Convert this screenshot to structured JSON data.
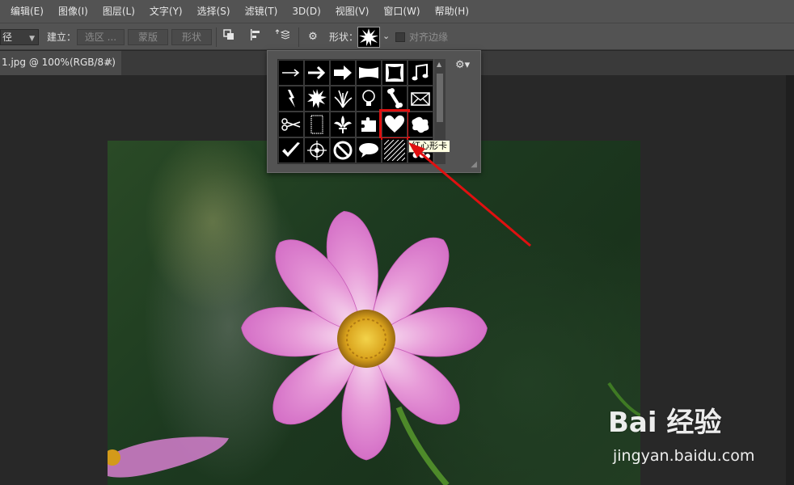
{
  "menu": [
    "编辑(E)",
    "图像(I)",
    "图层(L)",
    "文字(Y)",
    "选择(S)",
    "滤镜(T)",
    "3D(D)",
    "视图(V)",
    "窗口(W)",
    "帮助(H)"
  ],
  "options": {
    "mode_select": "径",
    "build_label": "建立：",
    "selection_btn": "选区 ...",
    "mask_btn": "蒙版",
    "shape_btn": "形状",
    "shape_label": "形状：",
    "align_edges_label": "对齐边缘"
  },
  "tab": {
    "title": "1.jpg @ 100%(RGB/8#)",
    "close": "×"
  },
  "shape_picker": {
    "shapes": [
      "arrow-thin-icon",
      "arrow-bold-icon",
      "arrow-fat-icon",
      "banner-icon",
      "frame-icon",
      "music-note-icon",
      "lightning-icon",
      "burst-icon",
      "grass-icon",
      "lightbulb-icon",
      "bone-icon",
      "envelope-icon",
      "scissors-icon",
      "frame-rect-icon",
      "fleur-de-lis-icon",
      "puzzle-icon",
      "heart-card-icon",
      "blob-icon",
      "checkmark-icon",
      "target-icon",
      "no-sign-icon",
      "speech-bubble-icon",
      "hatch-icon",
      "paws-icon"
    ],
    "selected": "heart-card-icon",
    "tooltip": "红心形卡"
  },
  "watermark": {
    "logo": "Bai 经验",
    "url": "jingyan.baidu.com"
  },
  "colors": {
    "highlight": "#e01010",
    "panel": "#535353",
    "canvas_bg": "#282828"
  }
}
